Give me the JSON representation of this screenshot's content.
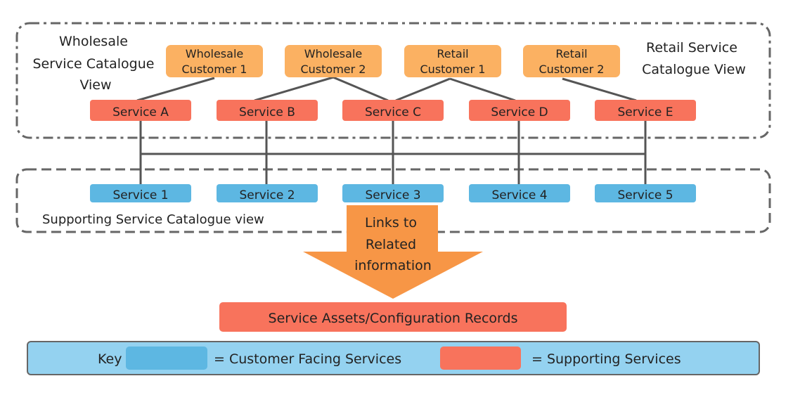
{
  "regions": {
    "wholesale_view": [
      "Wholesale",
      "Service Catalogue",
      "View"
    ],
    "retail_view": [
      "Retail Service",
      "Catalogue View"
    ],
    "supporting_view": "Supporting Service Catalogue view"
  },
  "customers": [
    {
      "line1": "Wholesale",
      "line2": "Customer 1"
    },
    {
      "line1": "Wholesale",
      "line2": "Customer 2"
    },
    {
      "line1": "Retail",
      "line2": "Customer 1"
    },
    {
      "line1": "Retail",
      "line2": "Customer 2"
    }
  ],
  "customer_services": [
    "Service A",
    "Service B",
    "Service C",
    "Service D",
    "Service E"
  ],
  "supporting_services": [
    "Service 1",
    "Service 2",
    "Service 3",
    "Service 4",
    "Service 5"
  ],
  "arrow": [
    "Links to",
    "Related",
    "information"
  ],
  "assets": "Service Assets/Configuration Records",
  "key": {
    "label": "Key",
    "blue_meaning": "= Customer Facing Services",
    "red_meaning": "= Supporting Services"
  },
  "colors": {
    "customer": "#FBB162",
    "service_red": "#F8735C",
    "service_blue": "#5DB7E2",
    "arrow": "#F79646",
    "key_bg": "#94D2F0"
  }
}
